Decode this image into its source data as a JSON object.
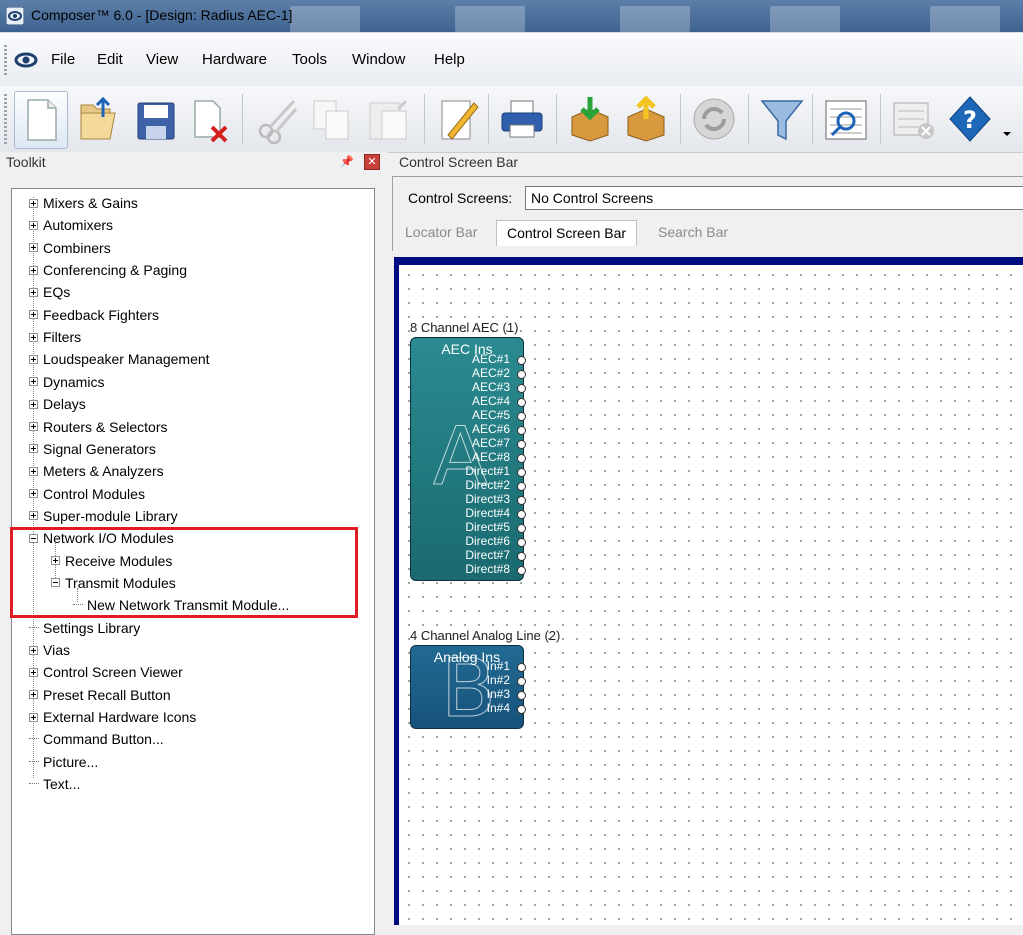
{
  "window": {
    "title": "Composer™ 6.0 - [Design: Radius AEC-1]"
  },
  "menu": [
    {
      "id": "file",
      "label": "File"
    },
    {
      "id": "edit",
      "label": "Edit"
    },
    {
      "id": "view",
      "label": "View"
    },
    {
      "id": "hardware",
      "label": "Hardware"
    },
    {
      "id": "tools",
      "label": "Tools"
    },
    {
      "id": "window",
      "label": "Window"
    },
    {
      "id": "help",
      "label": "Help"
    }
  ],
  "toolbar": {
    "buttons": [
      {
        "icon": "new-document-icon"
      },
      {
        "icon": "open-folder-icon"
      },
      {
        "icon": "save-icon"
      },
      {
        "icon": "close-document-icon"
      },
      {
        "icon": "cut-icon"
      },
      {
        "icon": "copy-icon"
      },
      {
        "icon": "paste-icon"
      },
      {
        "icon": "edit-icon"
      },
      {
        "icon": "print-icon"
      },
      {
        "icon": "download-icon"
      },
      {
        "icon": "upload-icon"
      },
      {
        "icon": "refresh-icon"
      },
      {
        "icon": "filter-icon"
      },
      {
        "icon": "inspect-icon"
      },
      {
        "icon": "delete-list-icon"
      },
      {
        "icon": "help-icon"
      }
    ]
  },
  "toolkit": {
    "title": "Toolkit",
    "tree": [
      {
        "label": "Mixers & Gains",
        "expander": "plus",
        "level": 0
      },
      {
        "label": "Automixers",
        "expander": "plus",
        "level": 0
      },
      {
        "label": "Combiners",
        "expander": "plus",
        "level": 0
      },
      {
        "label": "Conferencing & Paging",
        "expander": "plus",
        "level": 0
      },
      {
        "label": "EQs",
        "expander": "plus",
        "level": 0
      },
      {
        "label": "Feedback Fighters",
        "expander": "plus",
        "level": 0
      },
      {
        "label": "Filters",
        "expander": "plus",
        "level": 0
      },
      {
        "label": "Loudspeaker Management",
        "expander": "plus",
        "level": 0
      },
      {
        "label": "Dynamics",
        "expander": "plus",
        "level": 0
      },
      {
        "label": "Delays",
        "expander": "plus",
        "level": 0
      },
      {
        "label": "Routers & Selectors",
        "expander": "plus",
        "level": 0
      },
      {
        "label": "Signal Generators",
        "expander": "plus",
        "level": 0
      },
      {
        "label": "Meters & Analyzers",
        "expander": "plus",
        "level": 0
      },
      {
        "label": "Control Modules",
        "expander": "plus",
        "level": 0
      },
      {
        "label": "Super-module Library",
        "expander": "plus",
        "level": 0
      },
      {
        "label": "Network I/O Modules",
        "expander": "minus",
        "level": 0
      },
      {
        "label": "Receive Modules",
        "expander": "plus",
        "level": 1
      },
      {
        "label": "Transmit Modules",
        "expander": "minus",
        "level": 1
      },
      {
        "label": "New Network Transmit Module...",
        "expander": "leaf",
        "level": 2
      },
      {
        "label": "Settings Library",
        "expander": "leaf",
        "level": 0
      },
      {
        "label": "Vias",
        "expander": "plus",
        "level": 0
      },
      {
        "label": "Control Screen Viewer",
        "expander": "plus",
        "level": 0
      },
      {
        "label": "Preset Recall Button",
        "expander": "plus",
        "level": 0
      },
      {
        "label": "External Hardware Icons",
        "expander": "plus",
        "level": 0
      },
      {
        "label": "Command Button...",
        "expander": "leaf",
        "level": 0
      },
      {
        "label": "Picture...",
        "expander": "leaf",
        "level": 0
      },
      {
        "label": "Text...",
        "expander": "leaf",
        "level": 0
      }
    ]
  },
  "control_screen_bar": {
    "title": "Control Screen Bar",
    "screens_label": "Control Screens:",
    "screens_value": "No Control Screens",
    "tabs": [
      {
        "label": "Locator Bar",
        "active": false
      },
      {
        "label": "Control Screen Bar",
        "active": true
      },
      {
        "label": "Search Bar",
        "active": false
      }
    ]
  },
  "canvas": {
    "modules": [
      {
        "title": "8 Channel AEC (1)",
        "header": "AEC Ins",
        "letter": "A",
        "color": "#1f7a80",
        "ports": [
          "AEC#1",
          "AEC#2",
          "AEC#3",
          "AEC#4",
          "AEC#5",
          "AEC#6",
          "AEC#7",
          "AEC#8",
          "Direct#1",
          "Direct#2",
          "Direct#3",
          "Direct#4",
          "Direct#5",
          "Direct#6",
          "Direct#7",
          "Direct#8"
        ]
      },
      {
        "title": "4 Channel Analog Line (2)",
        "header": "Analog Ins",
        "letter": "B",
        "color": "#1b5c82",
        "ports": [
          "In#1",
          "In#2",
          "In#3",
          "In#4"
        ]
      }
    ]
  }
}
